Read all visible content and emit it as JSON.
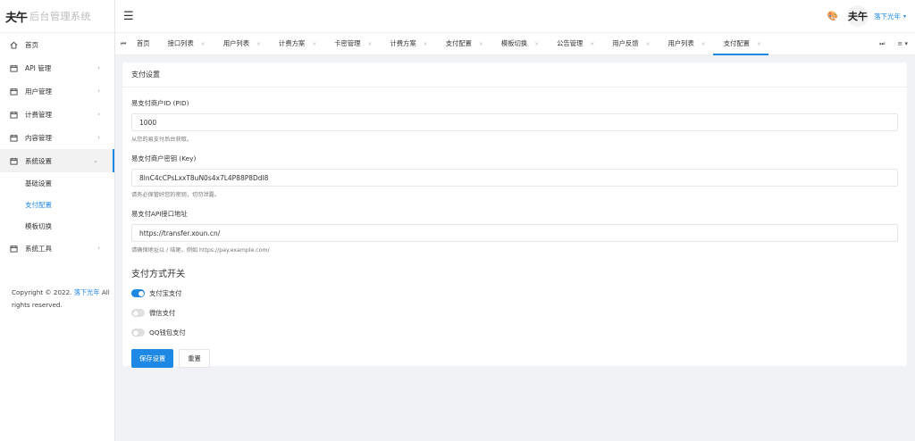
{
  "brand": {
    "mark": "夫午",
    "name": "后台管理系统"
  },
  "sidebar": {
    "items": [
      {
        "icon": "home-icon",
        "label": "首页"
      },
      {
        "icon": "api-icon",
        "label": "API 管理",
        "arrow": "›"
      },
      {
        "icon": "users-icon",
        "label": "用户管理",
        "arrow": "›"
      },
      {
        "icon": "billing-icon",
        "label": "计费管理",
        "arrow": "›"
      },
      {
        "icon": "content-icon",
        "label": "内容管理",
        "arrow": "›"
      }
    ],
    "system": {
      "icon": "settings-icon",
      "label": "系统设置",
      "arrow": "⌄"
    },
    "sub_items": [
      {
        "label": "基础设置"
      },
      {
        "label": "支付配置"
      },
      {
        "label": "模板切换"
      }
    ],
    "tools": {
      "icon": "tools-icon",
      "label": "系统工具",
      "arrow": "›"
    },
    "copyright": {
      "prefix": "Copyright © 2022.",
      "link": "落下光年",
      "suffix": "All rights reserved."
    }
  },
  "header": {
    "menu_icon": "☰",
    "palette_icon": "🎨",
    "avatar_text": "夫午",
    "user_name": "落下光年",
    "caret": "▾"
  },
  "tabbar": {
    "prev_icon": "⏮",
    "next_icon": "⏭",
    "more_icon": "≡ ▾",
    "close_icon": "×",
    "tabs": [
      {
        "label": "首页"
      },
      {
        "label": "接口列表"
      },
      {
        "label": "用户列表"
      },
      {
        "label": "计费方案"
      },
      {
        "label": "卡密管理"
      },
      {
        "label": "计费方案"
      },
      {
        "label": "支付配置"
      },
      {
        "label": "模板切换"
      },
      {
        "label": "公告管理"
      },
      {
        "label": "用户反馈"
      },
      {
        "label": "用户列表"
      },
      {
        "label": "支付配置"
      }
    ]
  },
  "card": {
    "title": "支付设置",
    "fields": [
      {
        "label": "易支付商户ID (PID)",
        "value": "1000",
        "help": "从您的易支付后台获取。"
      },
      {
        "label": "易支付商户密钥 (Key)",
        "value": "8lnC4cCPsLxxT8uN0s4x7L4P88P8Ddl8",
        "help": "请务必保管好您的密钥，切勿泄露。"
      },
      {
        "label": "易支付API接口地址",
        "value": "https://transfer.xoun.cn/",
        "help": "请确保地址以 / 结尾，例如 https://pay.example.com/"
      }
    ],
    "section_title": "支付方式开关",
    "switches": [
      {
        "label": "支付宝支付",
        "on": true
      },
      {
        "label": "微信支付",
        "on": false
      },
      {
        "label": "QQ钱包支付",
        "on": false
      }
    ],
    "save_label": "保存设置",
    "reset_label": "重置"
  },
  "colors": {
    "accent": "#1e88e5",
    "background": "#f0f2f5"
  }
}
